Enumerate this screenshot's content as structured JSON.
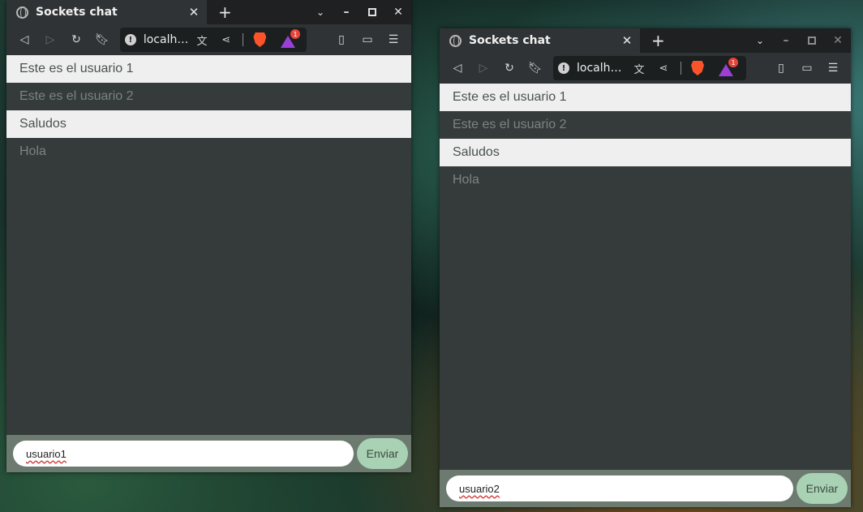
{
  "windows": [
    {
      "tab_title": "Sockets chat",
      "url": "localhost",
      "url_display": "localh…",
      "messages": [
        {
          "text": "Este es el usuario 1",
          "style": "light"
        },
        {
          "text": "Este es el usuario 2",
          "style": "dark"
        },
        {
          "text": "Saludos",
          "style": "light"
        },
        {
          "text": "Hola",
          "style": "dark"
        }
      ],
      "input_value": "usuario1",
      "send_label": "Enviar",
      "rewards_badge": "1"
    },
    {
      "tab_title": "Sockets chat",
      "url": "localhost",
      "url_display": "localho…",
      "messages": [
        {
          "text": "Este es el usuario 1",
          "style": "light"
        },
        {
          "text": "Este es el usuario 2",
          "style": "dark"
        },
        {
          "text": "Saludos",
          "style": "light"
        },
        {
          "text": "Hola",
          "style": "dark"
        }
      ],
      "input_value": "usuario2",
      "send_label": "Enviar",
      "rewards_badge": "1"
    }
  ],
  "icons": {
    "globe": "globe-icon",
    "close": "close-icon",
    "new_tab": "plus-icon",
    "back": "back-arrow-icon",
    "forward": "forward-arrow-icon",
    "reload": "reload-icon",
    "bookmark": "bookmark-icon",
    "info": "site-info-icon",
    "translate": "translate-icon",
    "share": "share-icon",
    "brave_shield": "brave-shield-icon",
    "rewards": "brave-rewards-icon",
    "sidebar": "sidebar-icon",
    "wallet": "wallet-icon",
    "menu": "hamburger-menu-icon"
  },
  "colors": {
    "message_light": "#efefef",
    "message_dark": "#353b3a",
    "form_bar": "#6c7a6f",
    "send_button": "#a9d1b4"
  }
}
